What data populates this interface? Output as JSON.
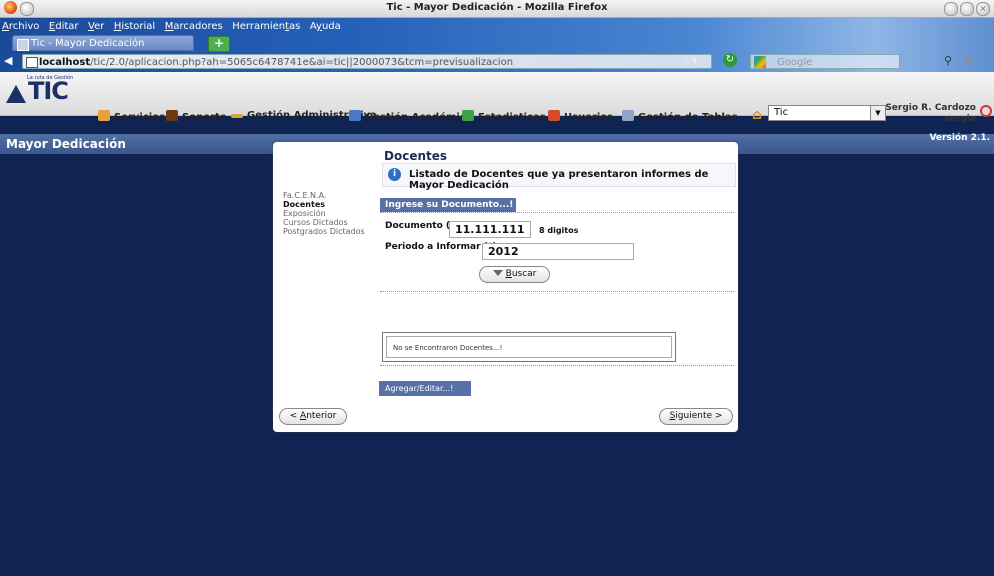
{
  "window": {
    "title": "Tic - Mayor Dedicación - Mozilla Firefox"
  },
  "menubar": [
    {
      "pre": "",
      "u": "A",
      "post": "rchivo"
    },
    {
      "pre": "",
      "u": "E",
      "post": "ditar"
    },
    {
      "pre": "",
      "u": "V",
      "post": "er"
    },
    {
      "pre": "",
      "u": "H",
      "post": "istorial"
    },
    {
      "pre": "",
      "u": "M",
      "post": "arcadores"
    },
    {
      "pre": "Herramien",
      "u": "t",
      "post": "as"
    },
    {
      "pre": "A",
      "u": "y",
      "post": "uda"
    }
  ],
  "tab": {
    "label": "Tic - Mayor Dedicación",
    "new_tab": "+"
  },
  "nav": {
    "url_host": "localhost",
    "url_rest": "/tic/2.0/aplicacion.php?ah=5065c6478741e&ai=tic||2000073&tcm=previsualizacion",
    "search_placeholder": "Google"
  },
  "app": {
    "logo_text": "TIC",
    "logo_tag": "La ruta de Gestión",
    "menu": [
      "Servicios",
      "Soporte",
      "Gestión Administrativa",
      "Gestión Académica",
      "Estadisticas",
      "Usuarios",
      "Gestión de Tablas"
    ],
    "project_select": "Tic",
    "user_name": "Sergio R. Cardozo",
    "user_login": "sergio",
    "version": "Versión 2.1."
  },
  "section": {
    "title": "Mayor Dedicación"
  },
  "sidenav": [
    "Fa.C.E.N.A.",
    "Docentes",
    "Exposición",
    "Cursos Dictados",
    "Postgrados Dictados"
  ],
  "content": {
    "heading": "Docentes",
    "info": "Listado de Docentes que ya presentaron informes de Mayor Dedicación",
    "form_header": "Ingrese su Documento...!",
    "documento_label": "Documento (*)",
    "documento_value": "11.111.111",
    "documento_hint": "8 digitos",
    "periodo_label": "Periodo a Informar (*)",
    "periodo_value": "2012",
    "buscar_u": "B",
    "buscar_rest": "uscar",
    "result": "No se Encontraron Docentes...!",
    "add_button": "Agregar/Editar...!"
  },
  "wizard": {
    "prev_pre": "< ",
    "prev_u": "A",
    "prev_rest": "nterior",
    "next_u": "S",
    "next_rest": "iguiente >"
  },
  "colors": {
    "desktop": "#0f2452",
    "section_bar": "#4a66a0",
    "form_header": "#5771a8"
  }
}
